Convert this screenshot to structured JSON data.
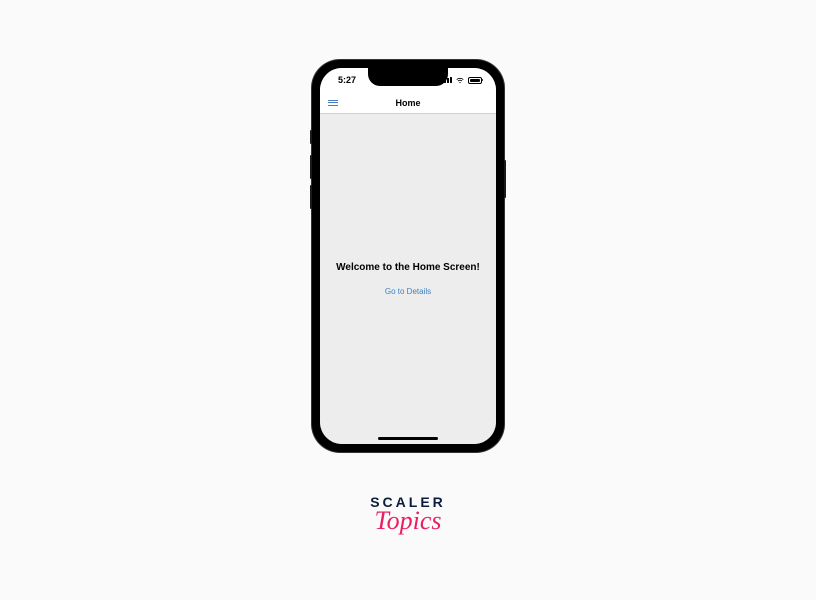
{
  "statusBar": {
    "time": "5:27"
  },
  "navHeader": {
    "title": "Home"
  },
  "content": {
    "welcome": "Welcome to the Home Screen!",
    "detailsLink": "Go to Details"
  },
  "brand": {
    "line1": "SCALER",
    "line2": "Topics"
  }
}
